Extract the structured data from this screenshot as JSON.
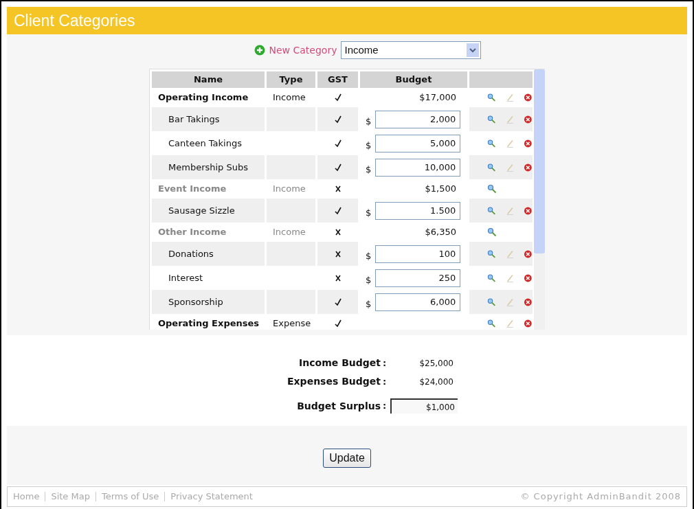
{
  "header": {
    "title": "Client Categories"
  },
  "new_category": {
    "label": "New Category",
    "select_value": "Income"
  },
  "table": {
    "columns": [
      "Name",
      "Type",
      "GST",
      "Budget"
    ],
    "rows": [
      {
        "kind": "group",
        "name": "Operating Income",
        "type": "Income",
        "gst": true,
        "budget": "$17,000",
        "disabled": false
      },
      {
        "kind": "item",
        "name": "Bar Takings",
        "gst": true,
        "currency": "$",
        "budget": "2,000"
      },
      {
        "kind": "item",
        "name": "Canteen Takings",
        "gst": true,
        "currency": "$",
        "budget": "5,000"
      },
      {
        "kind": "item",
        "name": "Membership Subs",
        "gst": true,
        "currency": "$",
        "budget": "10,000"
      },
      {
        "kind": "group",
        "name": "Event Income",
        "type": "Income",
        "gst": false,
        "budget": "$1,500",
        "disabled": true
      },
      {
        "kind": "item",
        "name": "Sausage Sizzle",
        "gst": true,
        "currency": "$",
        "budget": "1.500"
      },
      {
        "kind": "group",
        "name": "Other Income",
        "type": "Income",
        "gst": false,
        "budget": "$6,350",
        "disabled": true
      },
      {
        "kind": "item",
        "name": "Donations",
        "gst": false,
        "currency": "$",
        "budget": "100"
      },
      {
        "kind": "item",
        "name": "Interest",
        "gst": false,
        "currency": "$",
        "budget": "250"
      },
      {
        "kind": "item",
        "name": "Sponsorship",
        "gst": true,
        "currency": "$",
        "budget": "6,000"
      },
      {
        "kind": "group",
        "name": "Operating Expenses",
        "type": "Expense",
        "gst": true,
        "disabled": false
      }
    ]
  },
  "summary": [
    {
      "label": "Income Budget",
      "sep": ":",
      "value": "$25,000",
      "kind": "plain"
    },
    {
      "label": "Expenses Budget",
      "sep": ":",
      "value": "$24,000",
      "kind": "plain"
    },
    {
      "label": "Budget Surplus",
      "sep": ":",
      "value": "$1,000",
      "kind": "boxed"
    }
  ],
  "update_button": "Update",
  "footer": {
    "links": [
      "Home",
      "Site Map",
      "Terms of Use",
      "Privacy Statement"
    ],
    "copyright": "© Copyright AdminBandit 2008"
  }
}
